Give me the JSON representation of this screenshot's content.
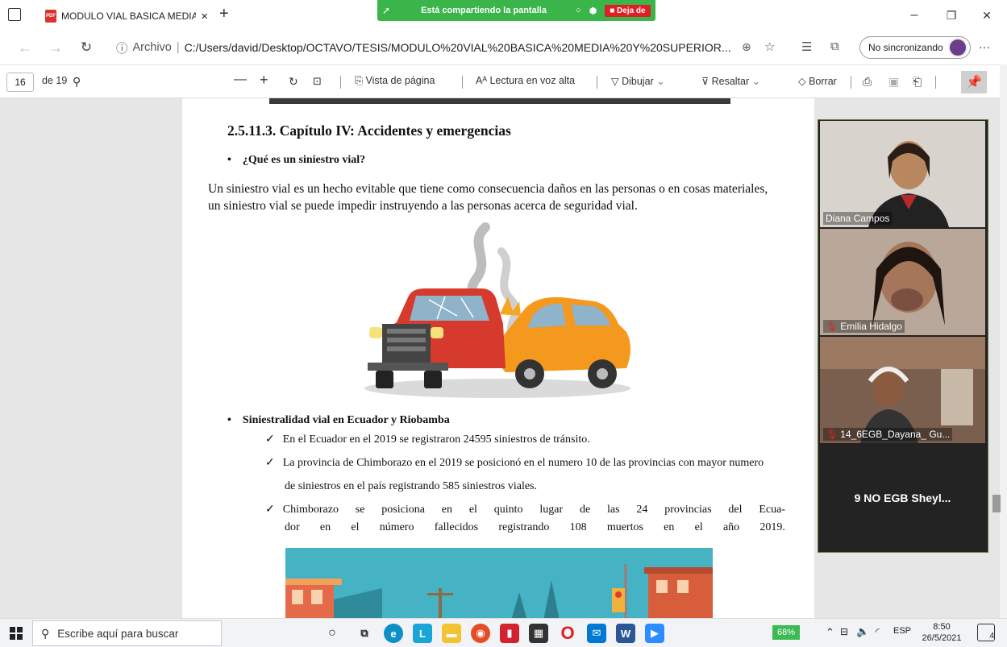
{
  "browser": {
    "tab_title": "MODULO VIAL BASICA MEDIA Y",
    "tab_close": "×",
    "new_tab": "+",
    "minimize": "–",
    "restore": "❐",
    "close": "✕",
    "info_label": "Archivo",
    "url": "C:/Users/david/Desktop/OCTAVO/TESIS/MODULO%20VIAL%20BASICA%20MEDIA%20Y%20SUPERIOR...",
    "sync_label": "No sincronizando",
    "more": "···"
  },
  "sharing": {
    "label": "Está compartiendo la pantalla",
    "stop_label": "Deja de"
  },
  "pdf_toolbar": {
    "page_current": "16",
    "page_total": "de 19",
    "page_view": "Vista de página",
    "read_aloud": "Lectura en voz alta",
    "draw": "Dibujar",
    "highlight": "Resaltar",
    "erase": "Borrar"
  },
  "document": {
    "heading": "2.5.11.3. Capítulo IV: Accidentes y emergencias",
    "question": "¿Qué es un siniestro vial?",
    "paragraph_line1": "Un siniestro vial es un hecho evitable que tiene como consecuencia daños en las personas o en cosas materiales,",
    "paragraph_line2": "un siniestro vial se puede impedir instruyendo a las personas acerca de seguridad vial.",
    "section2": "Siniestralidad vial en Ecuador y Riobamba",
    "item1": "En el Ecuador en el 2019 se registraron 24595 siniestros de tránsito.",
    "item2_line1": "La provincia de Chimborazo en el 2019 se posicionó en el numero 10 de las provincias con mayor numero",
    "item2_line2": "de siniestros en el país registrando 585 siniestros viales.",
    "item3_line1": [
      "Chimborazo",
      "se",
      "posiciona",
      "en",
      "el",
      "quinto",
      "lugar",
      "de",
      "las",
      "24",
      "provincias",
      "del",
      "Ecua-"
    ],
    "item3_line2": [
      "dor",
      "en",
      "el",
      "número",
      "fallecidos",
      "registrando",
      "108",
      "muertos",
      "en",
      "el",
      "año",
      "2019."
    ],
    "check": "✓",
    "bullet": "•"
  },
  "participants": [
    {
      "name": "Diana Campos"
    },
    {
      "name": "Emilia Hidalgo"
    },
    {
      "name": "14_6EGB_Dayana_ Gu..."
    },
    {
      "name": "9 NO EGB Sheyl..."
    }
  ],
  "taskbar": {
    "search_placeholder": "Escribe aquí para buscar",
    "battery": "68%",
    "language": "ESP",
    "time": "8:50",
    "date": "26/5/2021",
    "notifications": "4"
  }
}
